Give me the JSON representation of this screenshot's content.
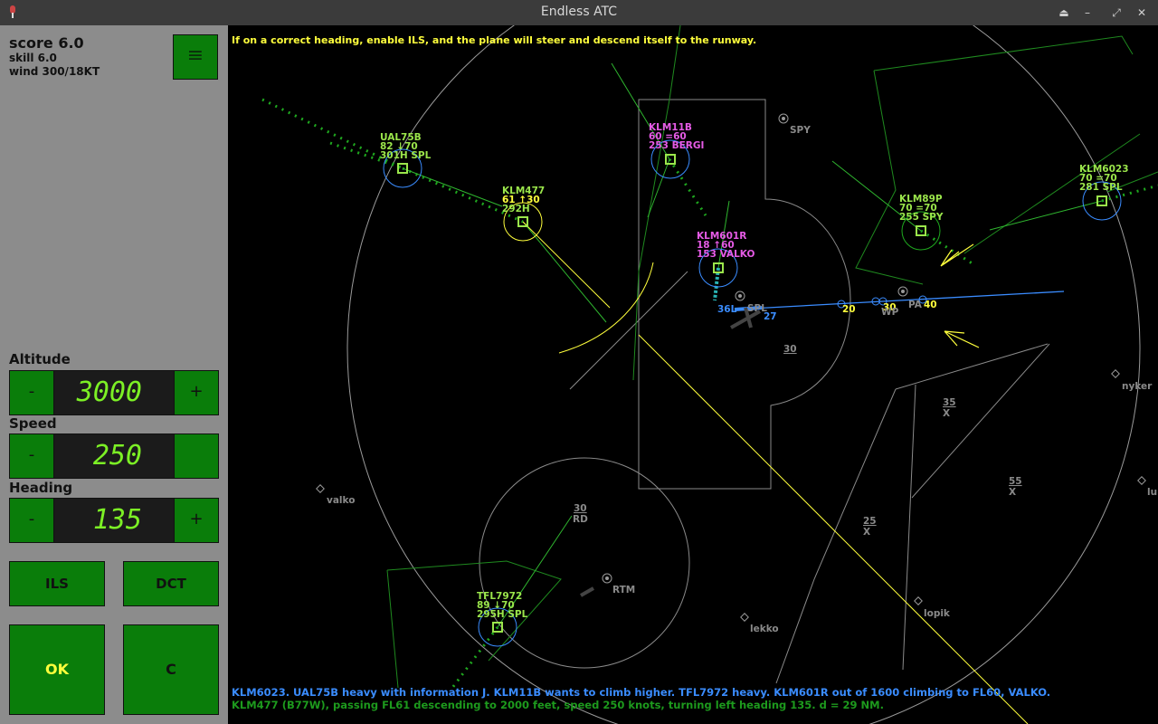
{
  "window": {
    "title": "Endless ATC"
  },
  "sidebar": {
    "score": "score 6.0",
    "skill": "skill 6.0",
    "wind": "wind 300/18KT",
    "menu_icon": "≡",
    "altitude": {
      "label": "Altitude",
      "minus": "-",
      "value": "3000",
      "plus": "+"
    },
    "speed": {
      "label": "Speed",
      "minus": "-",
      "value": "250",
      "plus": ""
    },
    "heading": {
      "label": "Heading",
      "minus": "-",
      "value": "135",
      "plus": "+"
    },
    "ils": "ILS",
    "dct": "DCT",
    "ok": "OK",
    "cancel": "C"
  },
  "hint": "If on a correct heading, enable ILS, and the plane will steer and descend itself to the runway.",
  "messages": {
    "line1": "KLM6023. UAL75B heavy with information J. KLM11B wants to climb higher. TFL7972 heavy. KLM601R out of 1600 climbing to FL60, VALKO.",
    "line2": "KLM477 (B77W), passing FL61 descending to 2000 feet, speed 250 knots, turning left heading 135. d = 29 NM."
  },
  "aircraft": [
    {
      "callsign": "UAL75B",
      "line2": "82 ↓70",
      "line3": "301H SPL",
      "color": "#9be64b"
    },
    {
      "callsign": "KLM477",
      "line2": "61 ↑30",
      "line3": "292H",
      "color": "#9be64b"
    },
    {
      "callsign": "KLM11B",
      "line2": "60 =60",
      "line3": "253  BERGI",
      "color": "#e65be6"
    },
    {
      "callsign": "KLM601R",
      "line2": "18 ↑60",
      "line3": "153  VALKO",
      "color": "#e65be6"
    },
    {
      "callsign": "KLM89P",
      "line2": "70 =70",
      "line3": "255  SPY",
      "color": "#9be64b"
    },
    {
      "callsign": "KLM6023",
      "line2": "70 =70",
      "line3": "281  SPL",
      "color": "#9be64b"
    },
    {
      "callsign": "TFL7972",
      "line2": "89 ↓70",
      "line3": "295H SPL",
      "color": "#9be64b"
    }
  ],
  "waypoints": {
    "spy": "SPY",
    "spl": "SPL",
    "pa": "PA",
    "wp": "WP",
    "valko": "valko",
    "rtm": "RTM",
    "lekko": "lekko",
    "lopik": "lopik",
    "nyker": "nyker",
    "lu": "lu"
  },
  "runway": {
    "r36l": "36L",
    "r27": "27"
  },
  "ils_marks": [
    "20",
    "30",
    "40"
  ],
  "sector_labels": {
    "s30": "30",
    "s30rd_top": "30",
    "s30rd_bot": "RD",
    "s35_top": "35",
    "s35_bot": "X",
    "s55_top": "55",
    "s55_bot": "X",
    "s25_top": "25",
    "s25_bot": "X"
  }
}
